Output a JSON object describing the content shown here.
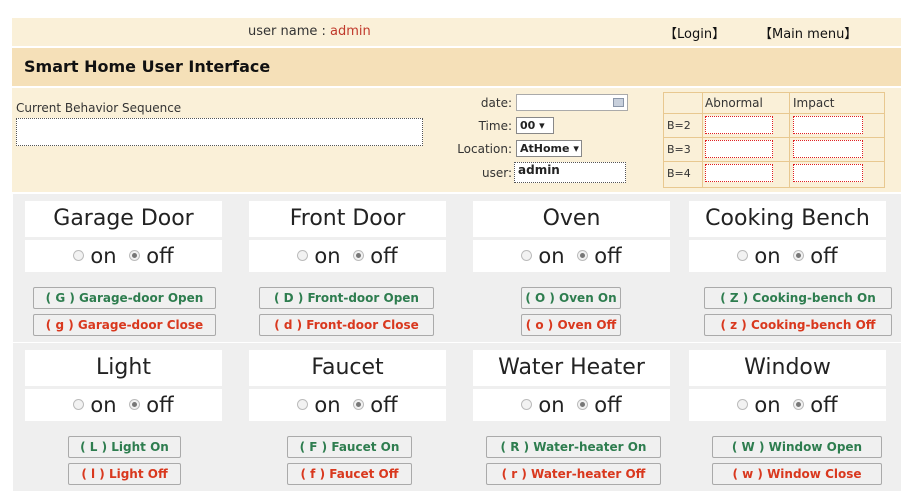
{
  "topbar": {
    "user_label": "user name : ",
    "user_name": "admin",
    "login_link": "【Login】",
    "main_menu_link": "【Main menu】"
  },
  "title": "Smart Home User Interface",
  "behavior": {
    "label": "Current Behavior Sequence",
    "value": ""
  },
  "form": {
    "date_label": "date:",
    "date_value": "",
    "time_label": "Time:",
    "time_value": "00",
    "location_label": "Location:",
    "location_value": "AtHome",
    "user_label": "user:",
    "user_value": "admin"
  },
  "btable": {
    "col_abnormal": "Abnormal",
    "col_impact": "Impact",
    "rows": [
      "B=2",
      "B=3",
      "B=4"
    ]
  },
  "radio_labels": {
    "on": "on",
    "off": "off"
  },
  "devices": [
    {
      "name": "Garage Door",
      "state": "off",
      "open_label": "( G ) Garage-door Open",
      "close_label": "( g ) Garage-door Close"
    },
    {
      "name": "Front Door",
      "state": "off",
      "open_label": "( D ) Front-door Open",
      "close_label": "( d ) Front-door Close"
    },
    {
      "name": "Oven",
      "state": "off",
      "open_label": "( O ) Oven On",
      "close_label": "( o ) Oven Off"
    },
    {
      "name": "Cooking Bench",
      "state": "off",
      "open_label": "( Z ) Cooking-bench On",
      "close_label": "( z ) Cooking-bench Off"
    },
    {
      "name": "Light",
      "state": "off",
      "open_label": "( L ) Light On",
      "close_label": "( l ) Light Off"
    },
    {
      "name": "Faucet",
      "state": "off",
      "open_label": "( F ) Faucet On",
      "close_label": "( f ) Faucet Off"
    },
    {
      "name": "Water Heater",
      "state": "off",
      "open_label": "( R ) Water-heater On",
      "close_label": "( r ) Water-heater Off"
    },
    {
      "name": "Window",
      "state": "off",
      "open_label": "( W ) Window Open",
      "close_label": "( w ) Window  Close"
    }
  ],
  "colors": {
    "open_button_text": "#2e7d4f",
    "close_button_text": "#d9381e",
    "username": "#c0392b"
  }
}
